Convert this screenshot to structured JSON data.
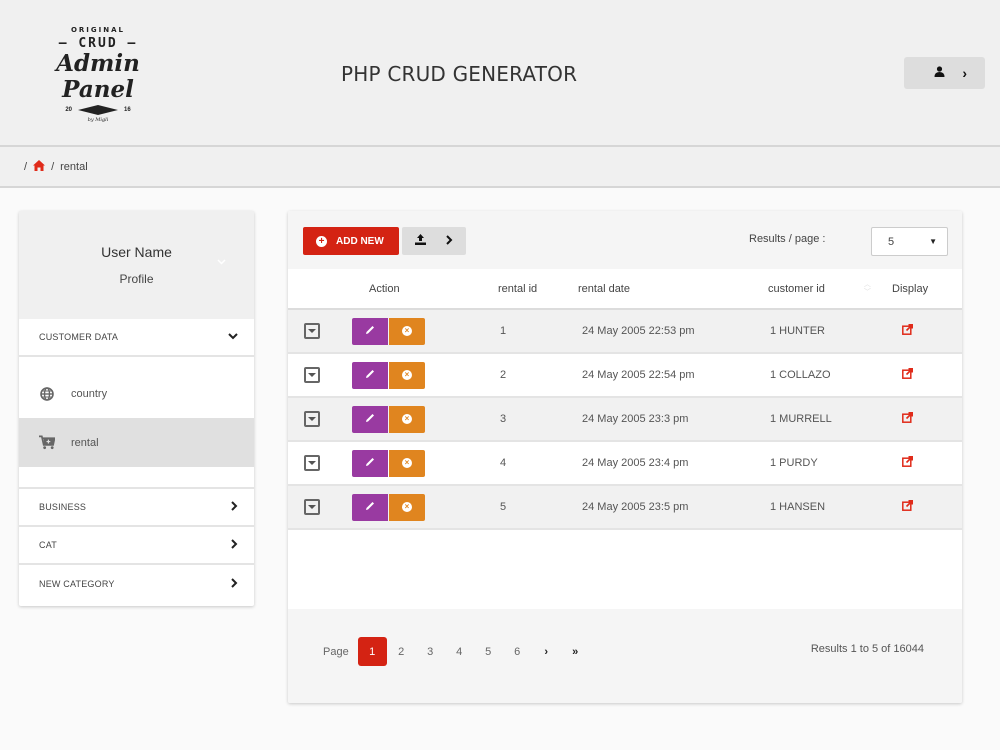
{
  "header": {
    "logo": {
      "line1": "ORIGINAL",
      "line2": "— CRUD —",
      "line3": "Admin Panel",
      "year_left": "20",
      "year_right": "16",
      "byline": "by Migli"
    },
    "app_title": "PHP CRUD GENERATOR",
    "user_menu": {
      "icon": "user-icon",
      "chevron": "›"
    }
  },
  "breadcrumb": {
    "separator": "/",
    "home_icon": "home-icon",
    "current": "rental"
  },
  "sidebar": {
    "profile": {
      "user_name": "User Name",
      "link": "Profile"
    },
    "categories": [
      {
        "label": "CUSTOMER DATA",
        "expanded": true,
        "items": [
          {
            "label": "country",
            "icon": "globe-icon",
            "active": false
          },
          {
            "label": "rental",
            "icon": "cart-icon",
            "active": true
          }
        ]
      },
      {
        "label": "BUSINESS",
        "expanded": false
      },
      {
        "label": "CAT",
        "expanded": false
      },
      {
        "label": "NEW CATEGORY",
        "expanded": false
      }
    ]
  },
  "toolbar": {
    "add_label": "ADD NEW",
    "export_icon": "upload-icon",
    "results_per_page_label": "Results / page :",
    "results_per_page_value": "5"
  },
  "table": {
    "columns": [
      "",
      "Action",
      "rental id",
      "rental date",
      "customer id",
      "Display"
    ],
    "rows": [
      {
        "rental_id": "1",
        "rental_date": "24 May 2005 22:53 pm",
        "customer_id": "1 HUNTER"
      },
      {
        "rental_id": "2",
        "rental_date": "24 May 2005 22:54 pm",
        "customer_id": "1 COLLAZO"
      },
      {
        "rental_id": "3",
        "rental_date": "24 May 2005 23:3 pm",
        "customer_id": "1 MURRELL"
      },
      {
        "rental_id": "4",
        "rental_date": "24 May 2005 23:4 pm",
        "customer_id": "1 PURDY"
      },
      {
        "rental_id": "5",
        "rental_date": "24 May 2005 23:5 pm",
        "customer_id": "1 HANSEN"
      }
    ]
  },
  "pagination": {
    "label": "Page",
    "pages": [
      "1",
      "2",
      "3",
      "4",
      "5",
      "6"
    ],
    "current_page": "1",
    "next": "›",
    "last": "»",
    "results_text": "Results 1 to 5 of 16044"
  },
  "colors": {
    "primary_red": "#d42313",
    "edit_purple": "#993aa1",
    "delete_orange": "#e0851f",
    "header_bg": "#f0f0f0"
  }
}
